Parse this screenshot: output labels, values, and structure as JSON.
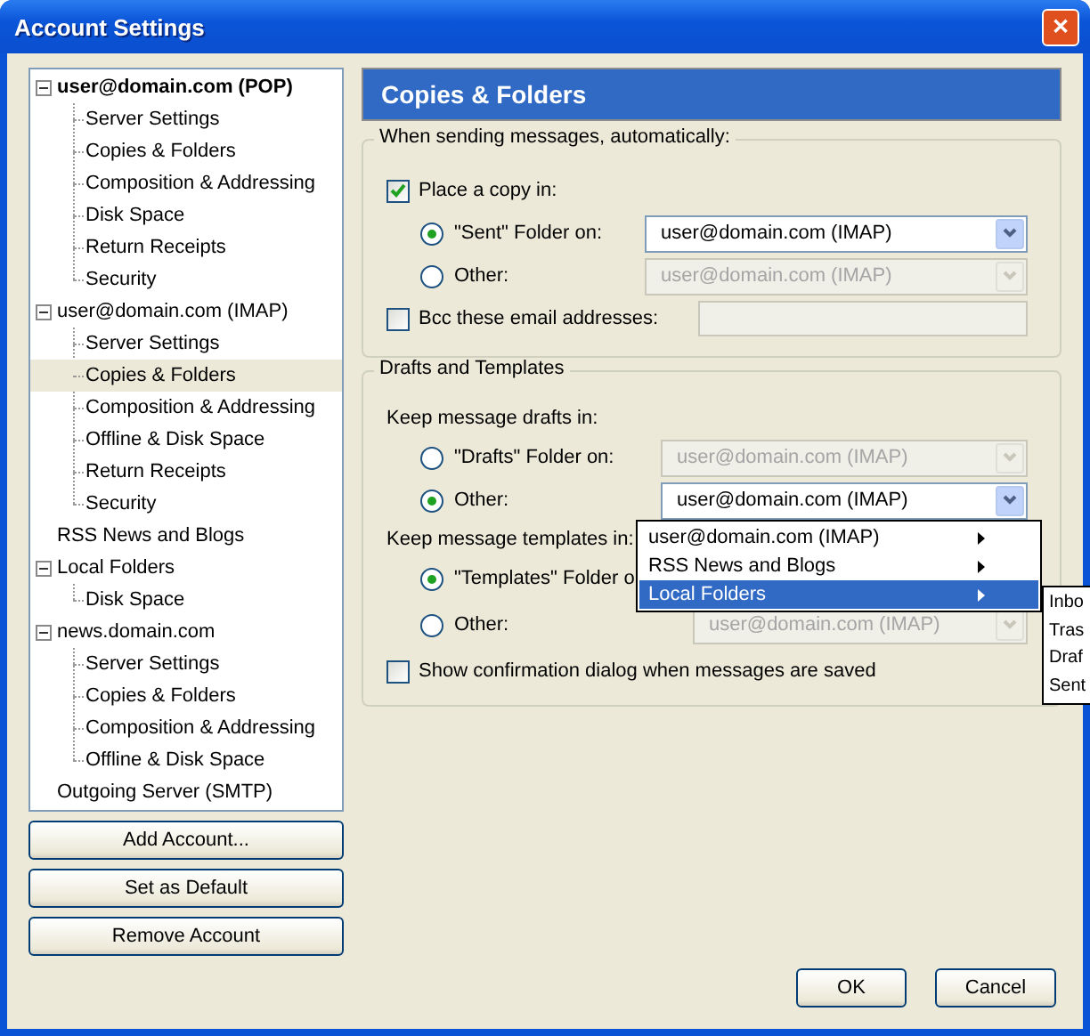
{
  "window": {
    "title": "Account Settings",
    "close": "✕"
  },
  "tree": [
    {
      "label": "user@domain.com  (POP)",
      "default": true,
      "expanded": true,
      "selected": false,
      "children": [
        {
          "label": "Server Settings",
          "selected": false
        },
        {
          "label": "Copies & Folders",
          "selected": false
        },
        {
          "label": "Composition & Addressing",
          "selected": false
        },
        {
          "label": "Disk Space",
          "selected": false
        },
        {
          "label": "Return Receipts",
          "selected": false
        },
        {
          "label": "Security",
          "selected": false
        }
      ]
    },
    {
      "label": "user@domain.com  (IMAP)",
      "default": false,
      "expanded": true,
      "selected": false,
      "children": [
        {
          "label": "Server Settings",
          "selected": false
        },
        {
          "label": "Copies & Folders",
          "selected": true
        },
        {
          "label": "Composition & Addressing",
          "selected": false
        },
        {
          "label": "Offline & Disk Space",
          "selected": false
        },
        {
          "label": "Return Receipts",
          "selected": false
        },
        {
          "label": "Security",
          "selected": false
        }
      ]
    },
    {
      "label": "RSS News and Blogs",
      "default": false,
      "selected": false
    },
    {
      "label": "Local Folders",
      "default": false,
      "expanded": true,
      "selected": false,
      "children": [
        {
          "label": "Disk Space",
          "selected": false
        }
      ]
    },
    {
      "label": "news.domain.com",
      "default": false,
      "expanded": true,
      "selected": false,
      "children": [
        {
          "label": "Server Settings",
          "selected": false
        },
        {
          "label": "Copies & Folders",
          "selected": false
        },
        {
          "label": "Composition & Addressing",
          "selected": false
        },
        {
          "label": "Offline & Disk Space",
          "selected": false
        }
      ]
    },
    {
      "label": "Outgoing Server (SMTP)",
      "default": false,
      "selected": false
    }
  ],
  "account_buttons": [
    "Add Account...",
    "Set as Default",
    "Remove Account"
  ],
  "panel": {
    "title": "Copies & Folders",
    "sending": {
      "legend": "When sending messages, automatically:",
      "place_copy": {
        "label": "Place a copy in:",
        "checked": true
      },
      "options": [
        {
          "label": "\"Sent\" Folder on:",
          "selected": true,
          "value": "user@domain.com  (IMAP)",
          "disabled": false
        },
        {
          "label": "Other:",
          "selected": false,
          "value": "user@domain.com  (IMAP)",
          "disabled": true
        }
      ],
      "bcc": {
        "label": "Bcc these email addresses:",
        "checked": false
      }
    },
    "drafts": {
      "legend": "Drafts and Templates",
      "drafts_label": "Keep message drafts in:",
      "drafts_options": [
        {
          "label": "\"Drafts\" Folder on:",
          "selected": false,
          "value": "user@domain.com  (IMAP)",
          "disabled": true
        },
        {
          "label": "Other:",
          "selected": true,
          "value": "user@domain.com  (IMAP)",
          "disabled": false
        }
      ],
      "templates_label": "Keep message templates in:",
      "templates_options": [
        {
          "label": "\"Templates\" Folder o",
          "selected": true
        },
        {
          "label": "Other:",
          "selected": false,
          "value": "user@domain.com  (IMAP)",
          "disabled": true
        }
      ],
      "confirm": {
        "label": "Show confirmation dialog when messages are saved",
        "checked": false
      }
    }
  },
  "menu": [
    {
      "label": "user@domain.com  (IMAP)",
      "selected": false,
      "submenu": true
    },
    {
      "label": "RSS News and Blogs",
      "selected": false,
      "submenu": true
    },
    {
      "label": "Local Folders",
      "selected": true,
      "submenu": true
    }
  ],
  "submenu": [
    "Inbo",
    "Tras",
    "Draf",
    "Sent"
  ],
  "buttons": [
    "OK",
    "Cancel"
  ]
}
